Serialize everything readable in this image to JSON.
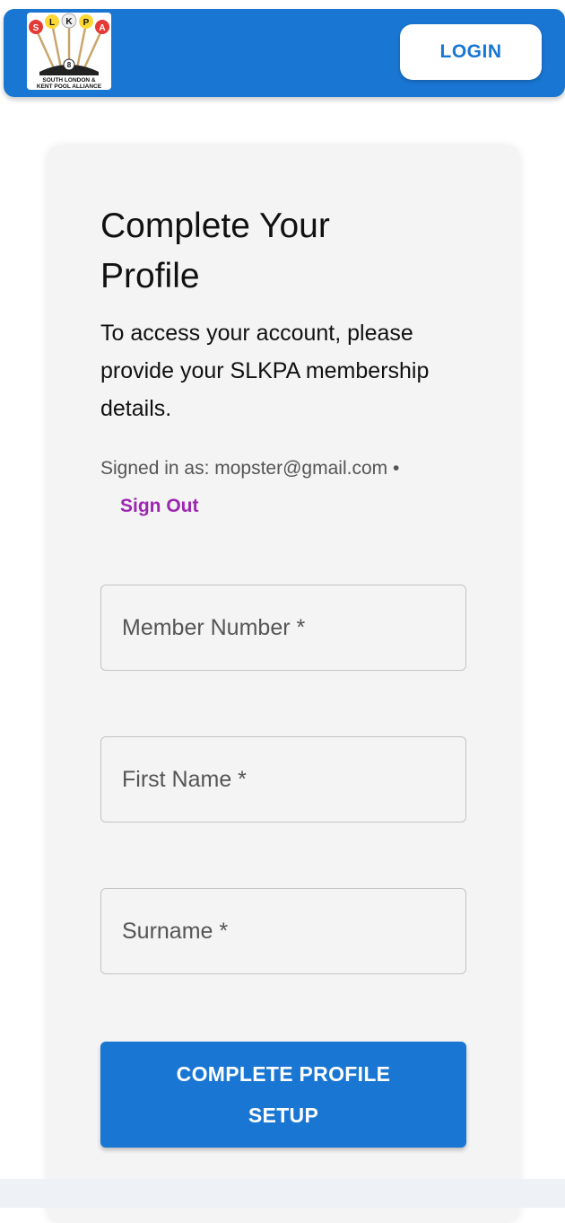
{
  "header": {
    "logo": {
      "letters": [
        "S",
        "L",
        "K",
        "P",
        "A"
      ],
      "ball_number": "8",
      "caption_line1": "SOUTH LONDON &",
      "caption_line2": "KENT POOL ALLIANCE"
    },
    "login_label": "LOGIN"
  },
  "form": {
    "title": "Complete Your Profile",
    "intro": "To access your account, please provide your SLKPA membership details.",
    "signed_in_text": "Signed in as: mopster@gmail.com •",
    "sign_out_label": "Sign Out",
    "fields": [
      {
        "placeholder": "Member Number *",
        "value": ""
      },
      {
        "placeholder": "First Name *",
        "value": ""
      },
      {
        "placeholder": "Surname *",
        "value": ""
      }
    ],
    "submit_label": "COMPLETE PROFILE SETUP"
  },
  "colors": {
    "primary": "#1976d2",
    "link": "#9c27b0",
    "card": "#f4f4f4"
  }
}
